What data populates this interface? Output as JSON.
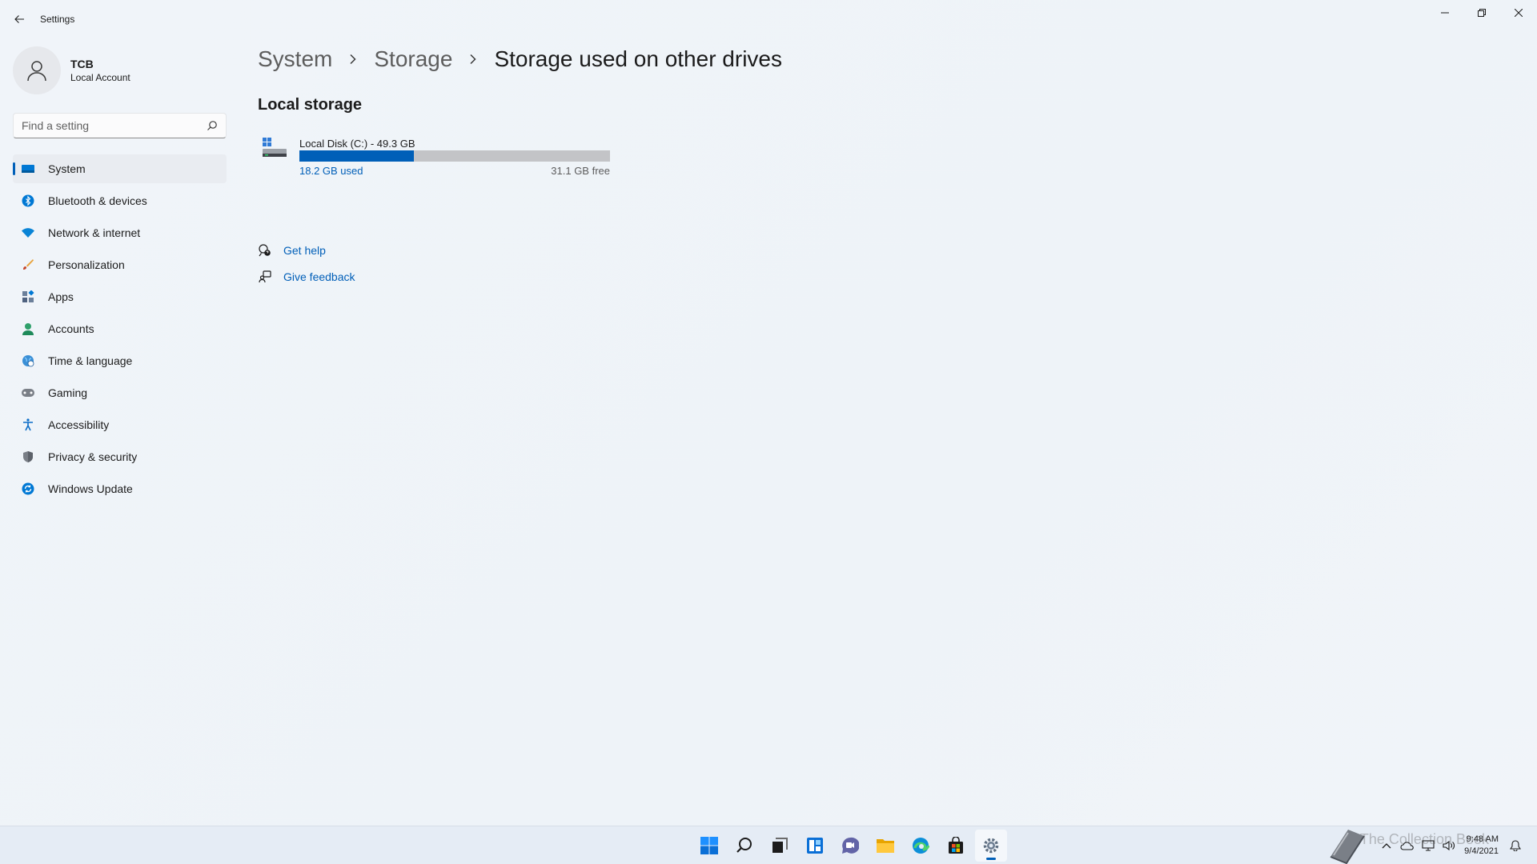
{
  "window": {
    "title": "Settings"
  },
  "profile": {
    "name": "TCB",
    "account_type": "Local Account"
  },
  "search": {
    "placeholder": "Find a setting"
  },
  "sidebar": {
    "items": [
      {
        "label": "System",
        "icon": "system-icon",
        "selected": true
      },
      {
        "label": "Bluetooth & devices",
        "icon": "bluetooth-icon"
      },
      {
        "label": "Network & internet",
        "icon": "wifi-icon"
      },
      {
        "label": "Personalization",
        "icon": "brush-icon"
      },
      {
        "label": "Apps",
        "icon": "apps-icon"
      },
      {
        "label": "Accounts",
        "icon": "person-icon"
      },
      {
        "label": "Time & language",
        "icon": "globe-clock-icon"
      },
      {
        "label": "Gaming",
        "icon": "gamepad-icon"
      },
      {
        "label": "Accessibility",
        "icon": "accessibility-icon"
      },
      {
        "label": "Privacy & security",
        "icon": "shield-icon"
      },
      {
        "label": "Windows Update",
        "icon": "update-icon"
      }
    ]
  },
  "breadcrumb": {
    "items": [
      "System",
      "Storage",
      "Storage used on other drives"
    ]
  },
  "local_storage": {
    "heading": "Local storage",
    "drive": {
      "name": "Local Disk (C:) - 49.3 GB",
      "used_text": "18.2 GB used",
      "free_text": "31.1 GB free",
      "used_fraction": 0.369
    }
  },
  "help_links": {
    "get_help": "Get help",
    "give_feedback": "Give feedback"
  },
  "taskbar": {
    "icons": [
      "start-icon",
      "search-icon",
      "task-view-icon",
      "widgets-icon",
      "chat-icon",
      "file-explorer-icon",
      "edge-icon",
      "store-icon",
      "settings-icon"
    ],
    "active": "settings-icon",
    "time": "9:48 AM",
    "date": "9/4/2021",
    "watermark": "The Collection Book"
  },
  "colors": {
    "accent": "#005fb8",
    "bar_track": "#c3c4c7",
    "background": "#f0f4f9"
  }
}
